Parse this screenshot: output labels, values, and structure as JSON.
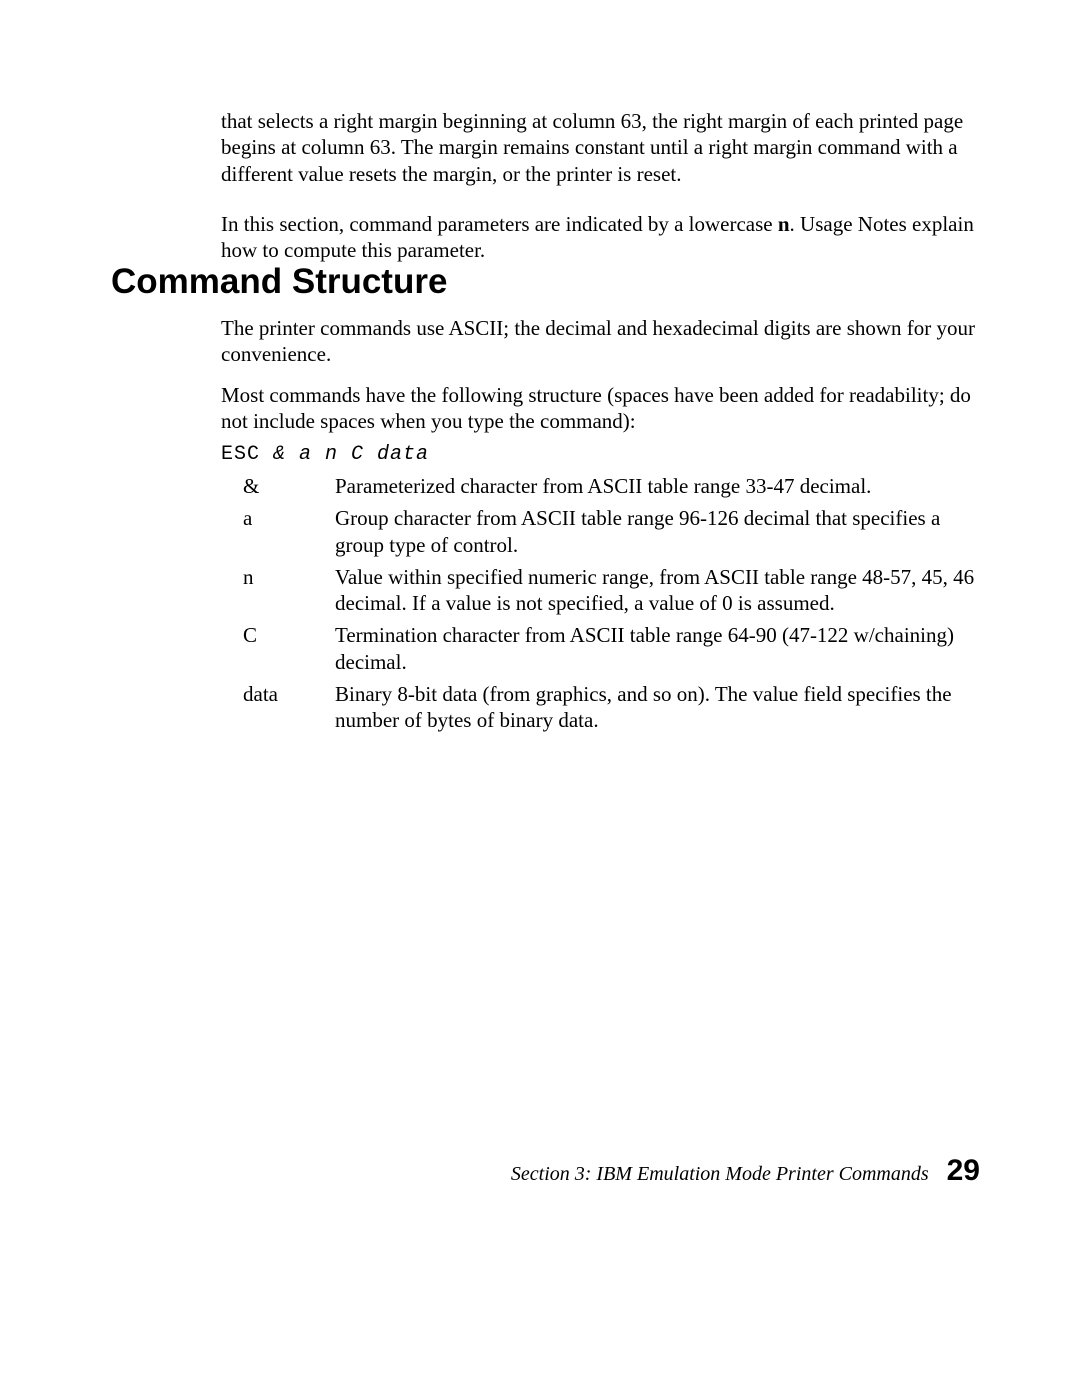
{
  "intro": {
    "p1": "that selects a right margin beginning at column 63, the right margin of each printed page begins at column 63. The margin remains constant until a right margin command with a different value resets the margin, or the printer is reset.",
    "p2_a": "In this section, command parameters are indicated by a lowercase ",
    "p2_bold": "n",
    "p2_b": ". Usage Notes explain how to compute this parameter."
  },
  "heading": "Command Structure",
  "section": {
    "p1": "The printer commands use ASCII; the decimal and hexadecimal digits are shown for your convenience.",
    "p2": "Most  commands have the following structure (spaces have been added for readability; do not include spaces when you type the command):",
    "code_prefix": "ESC ",
    "code_italic": "& a n C data"
  },
  "defs": [
    {
      "term": "&",
      "desc": "Parameterized character from ASCII table range 33-47 decimal."
    },
    {
      "term": "a",
      "desc": "Group character from ASCII table range 96-126 decimal that specifies a group type of control."
    },
    {
      "term": "n",
      "desc": "Value within specified numeric range, from ASCII table range 48-57, 45, 46 decimal. If a value is not specified, a value of 0 is assumed."
    },
    {
      "term": "C",
      "desc": "Termination character from ASCII table range 64-90 (47-122 w/chaining) decimal."
    },
    {
      "term": "data",
      "desc": "Binary 8-bit data (from graphics, and so on). The value field specifies the number of bytes of binary data."
    }
  ],
  "footer": {
    "text": "Section 3: IBM Emulation Mode Printer Commands",
    "page": "29"
  }
}
